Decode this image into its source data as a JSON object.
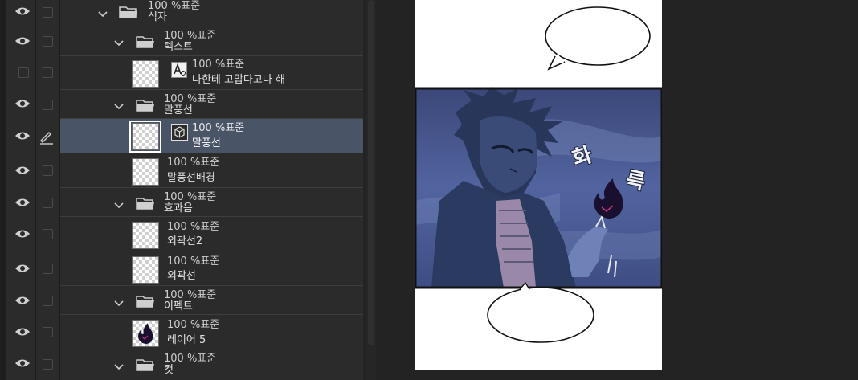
{
  "layers": [
    {
      "kind": "folder",
      "mode": "100 %표준",
      "name": "식자",
      "visible": true
    },
    {
      "kind": "folder",
      "mode": "100 %표준",
      "name": "텍스트",
      "visible": true
    },
    {
      "kind": "text",
      "mode": "100 %표준",
      "name": "나한테 고맙다고나 해",
      "visible": false,
      "type_icon": "text-layer-icon"
    },
    {
      "kind": "folder",
      "mode": "100 %표준",
      "name": "말풍선",
      "visible": true
    },
    {
      "kind": "balloon",
      "mode": "100 %표준",
      "name": "말풍선",
      "visible": true,
      "selected": true,
      "type_icon": "vector-layer-icon"
    },
    {
      "kind": "raster",
      "mode": "100 %표준",
      "name": "말풍선배경",
      "visible": true
    },
    {
      "kind": "folder",
      "mode": "100 %표준",
      "name": "효과음",
      "visible": true
    },
    {
      "kind": "raster",
      "mode": "100 %표준",
      "name": "외곽선2",
      "visible": true
    },
    {
      "kind": "raster",
      "mode": "100 %표준",
      "name": "외곽선",
      "visible": true
    },
    {
      "kind": "folder",
      "mode": "100 %표준",
      "name": "이펙트",
      "visible": true
    },
    {
      "kind": "raster",
      "mode": "100 %표준",
      "name": "레이어 5",
      "visible": true,
      "thumb": "flame"
    },
    {
      "kind": "folder",
      "mode": "100 %표준",
      "name": "컷",
      "visible": true
    }
  ],
  "canvas": {
    "sfx_text": [
      "화",
      "륵"
    ],
    "panel_colors": {
      "sky": "#4a5a8c",
      "character": "#2c3a5c",
      "border": "#111111"
    }
  },
  "colors": {
    "selected_row": "#4a5467",
    "panel_bg": "#2b2b2b"
  }
}
